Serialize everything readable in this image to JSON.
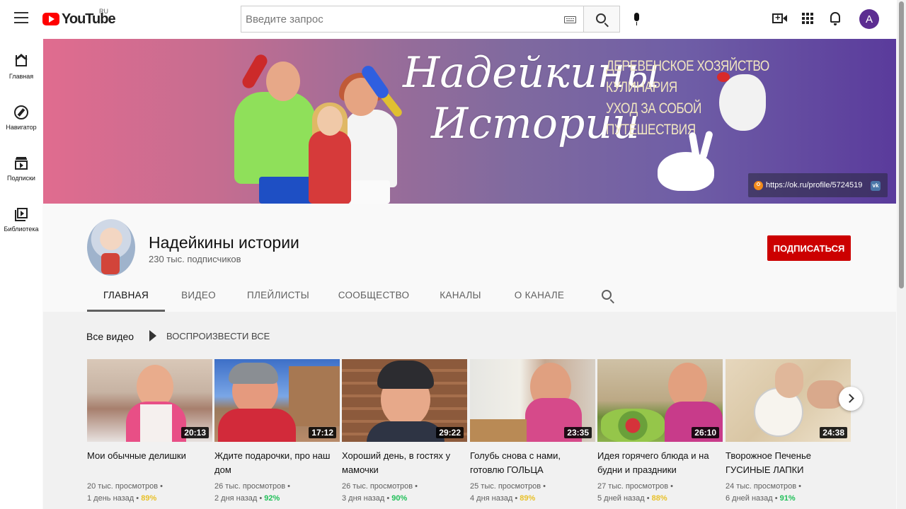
{
  "header": {
    "logo_text": "YouTube",
    "region": "RU",
    "search_placeholder": "Введите запрос",
    "avatar_letter": "A",
    "icons": [
      "menu-icon",
      "keyboard-icon",
      "search-icon",
      "mic-icon",
      "create-video-icon",
      "apps-icon",
      "bell-icon"
    ]
  },
  "sidebar": {
    "items": [
      {
        "label": "Главная",
        "icon": "home-icon"
      },
      {
        "label": "Навигатор",
        "icon": "compass-icon"
      },
      {
        "label": "Подписки",
        "icon": "subscriptions-icon"
      },
      {
        "label": "Библиотека",
        "icon": "library-icon"
      }
    ]
  },
  "banner": {
    "title_line1": "Надейкины",
    "title_line2": "Истории",
    "topics": [
      "ДЕРЕВЕНСКОЕ ХОЗЯЙСТВО",
      "КУЛИНАРИЯ",
      "УХОД ЗА СОБОЙ",
      "ПУТЕШЕСТВИЯ"
    ],
    "link_text": "https://ok.ru/profile/5724519"
  },
  "channel": {
    "name": "Надейкины истории",
    "subscribers": "230 тыс. подписчиков",
    "subscribe_label": "ПОДПИСАТЬСЯ",
    "tabs": [
      "ГЛАВНАЯ",
      "ВИДЕО",
      "ПЛЕЙЛИСТЫ",
      "СООБЩЕСТВО",
      "КАНАЛЫ",
      "О КАНАЛЕ"
    ],
    "active_tab": "ГЛАВНАЯ"
  },
  "shelf": {
    "title": "Все видео",
    "play_all": "ВОСПРОИЗВЕСТИ ВСЕ",
    "videos": [
      {
        "title": "Мои обычные делишки",
        "duration": "20:13",
        "views": "20 тыс. просмотров",
        "age": "1 день назад",
        "rating": "89%",
        "rating_color": "#e8c12a"
      },
      {
        "title": "Ждите подарочки, про наш дом",
        "duration": "17:12",
        "views": "26 тыс. просмотров",
        "age": "2 дня назад",
        "rating": "92%",
        "rating_color": "#22c05a"
      },
      {
        "title": "Хороший день, в гостях у мамочки",
        "duration": "29:22",
        "views": "26 тыс. просмотров",
        "age": "3 дня назад",
        "rating": "90%",
        "rating_color": "#22c05a"
      },
      {
        "title": "Голубь снова с нами, готовлю ГОЛЬЦА",
        "duration": "23:35",
        "views": "25 тыс. просмотров",
        "age": "4 дня назад",
        "rating": "89%",
        "rating_color": "#e8c12a"
      },
      {
        "title": "Идея горячего блюда и на будни и праздники",
        "duration": "26:10",
        "views": "27 тыс. просмотров",
        "age": "5 дней назад",
        "rating": "88%",
        "rating_color": "#e8c12a"
      },
      {
        "title": "Творожное Печенье ГУСИНЫЕ ЛАПКИ",
        "duration": "24:38",
        "views": "24 тыс. просмотров",
        "age": "6 дней назад",
        "rating": "91%",
        "rating_color": "#22c05a"
      }
    ]
  },
  "colors": {
    "subscribe_red": "#cc0000",
    "youtube_red": "#ff0000",
    "avatar_purple": "#5c2d91"
  }
}
